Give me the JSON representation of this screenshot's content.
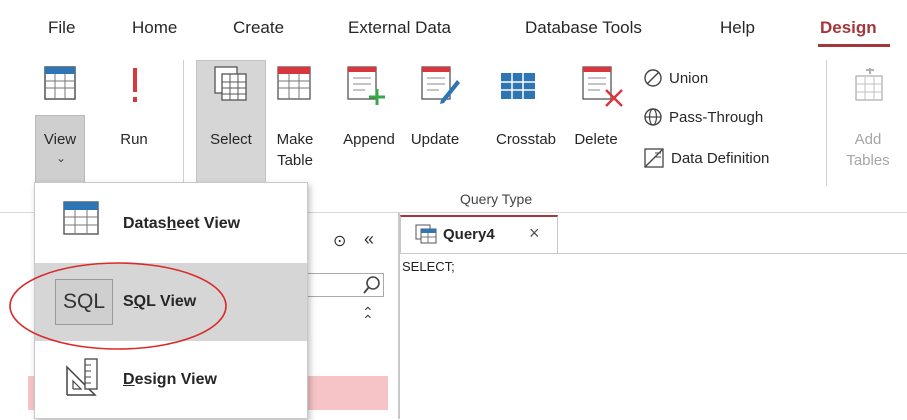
{
  "tabs": {
    "file": "File",
    "home": "Home",
    "create": "Create",
    "external_data": "External Data",
    "database_tools": "Database Tools",
    "help": "Help",
    "design": "Design"
  },
  "ribbon": {
    "view_label": "View",
    "run_label": "Run",
    "select_label": "Select",
    "make_table_label_1": "Make",
    "make_table_label_2": "Table",
    "append_label": "Append",
    "update_label": "Update",
    "crosstab_label": "Crosstab",
    "delete_label": "Delete",
    "union_label": "Union",
    "pass_through_label": "Pass-Through",
    "data_definition_label": "Data Definition",
    "add_tables_label_1": "Add",
    "add_tables_label_2": "Tables",
    "group_query_type": "Query Type"
  },
  "view_menu": {
    "datasheet_prefix": "Datas",
    "datasheet_accel": "h",
    "datasheet_suffix": "eet View",
    "sql_icon_text": "SQL",
    "sql_prefix": "S",
    "sql_accel": "Q",
    "sql_suffix": "L View",
    "design_accel": "D",
    "design_suffix": "esign View"
  },
  "document_tab": {
    "label": "Query4",
    "close_glyph": "×"
  },
  "editor": {
    "content": "SELECT;"
  },
  "nav": {
    "dropdown_glyph": "⊙",
    "collapse_glyph": "«",
    "up_glyph": "⌃"
  },
  "colors": {
    "accent": "#a4373a",
    "annotation_ellipse": "#d92b2b",
    "selected_bg": "#d6d6d6",
    "icon_blue": "#2e75b6",
    "icon_green": "#3aa64b",
    "icon_red": "#d9363e"
  }
}
